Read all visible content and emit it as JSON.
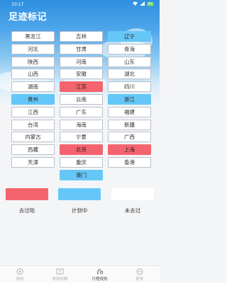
{
  "status_bar": {
    "time": "10:17",
    "battery": "89"
  },
  "title": "足迹标记",
  "colors": {
    "planned": "#65c7f7",
    "visited": "#f4646e",
    "not_visited": "#ffffff",
    "header": "#2f8fe0"
  },
  "provinces": [
    [
      {
        "name": "黑龙江",
        "status": "none"
      },
      {
        "name": "吉林",
        "status": "none"
      },
      {
        "name": "辽宁",
        "status": "planned"
      }
    ],
    [
      {
        "name": "河北",
        "status": "none"
      },
      {
        "name": "甘肃",
        "status": "none"
      },
      {
        "name": "青海",
        "status": "none"
      }
    ],
    [
      {
        "name": "陕西",
        "status": "none"
      },
      {
        "name": "河南",
        "status": "none"
      },
      {
        "name": "山东",
        "status": "none"
      }
    ],
    [
      {
        "name": "山西",
        "status": "none"
      },
      {
        "name": "安徽",
        "status": "none"
      },
      {
        "name": "湖北",
        "status": "none"
      }
    ],
    [
      {
        "name": "湖南",
        "status": "none"
      },
      {
        "name": "江苏",
        "status": "visited"
      },
      {
        "name": "四川",
        "status": "none"
      }
    ],
    [
      {
        "name": "贵州",
        "status": "planned"
      },
      {
        "name": "云南",
        "status": "none"
      },
      {
        "name": "浙江",
        "status": "planned"
      }
    ],
    [
      {
        "name": "江西",
        "status": "none"
      },
      {
        "name": "广东",
        "status": "none"
      },
      {
        "name": "福建",
        "status": "none"
      }
    ],
    [
      {
        "name": "台湾",
        "status": "none"
      },
      {
        "name": "海南",
        "status": "none"
      },
      {
        "name": "新疆",
        "status": "none"
      }
    ],
    [
      {
        "name": "内蒙古",
        "status": "none"
      },
      {
        "name": "宁夏",
        "status": "none"
      },
      {
        "name": "广西",
        "status": "none"
      }
    ],
    [
      {
        "name": "西藏",
        "status": "none"
      },
      {
        "name": "北京",
        "status": "visited"
      },
      {
        "name": "上海",
        "status": "visited"
      }
    ],
    [
      {
        "name": "天津",
        "status": "none"
      },
      {
        "name": "重庆",
        "status": "none"
      },
      {
        "name": "香港",
        "status": "none"
      }
    ],
    [
      null,
      {
        "name": "澳门",
        "status": "planned"
      },
      null
    ]
  ],
  "legend": [
    {
      "label": "去过啦",
      "status": "visited"
    },
    {
      "label": "计划中",
      "status": "planned"
    },
    {
      "label": "未去过",
      "status": "none"
    }
  ],
  "tabs": [
    {
      "label": "导航",
      "icon": "navigation-icon",
      "active": false
    },
    {
      "label": "旅游攻略",
      "icon": "guide-icon",
      "active": false
    },
    {
      "label": "行程规划",
      "icon": "plan-icon",
      "active": true
    },
    {
      "label": "更多",
      "icon": "more-icon",
      "active": false
    }
  ]
}
